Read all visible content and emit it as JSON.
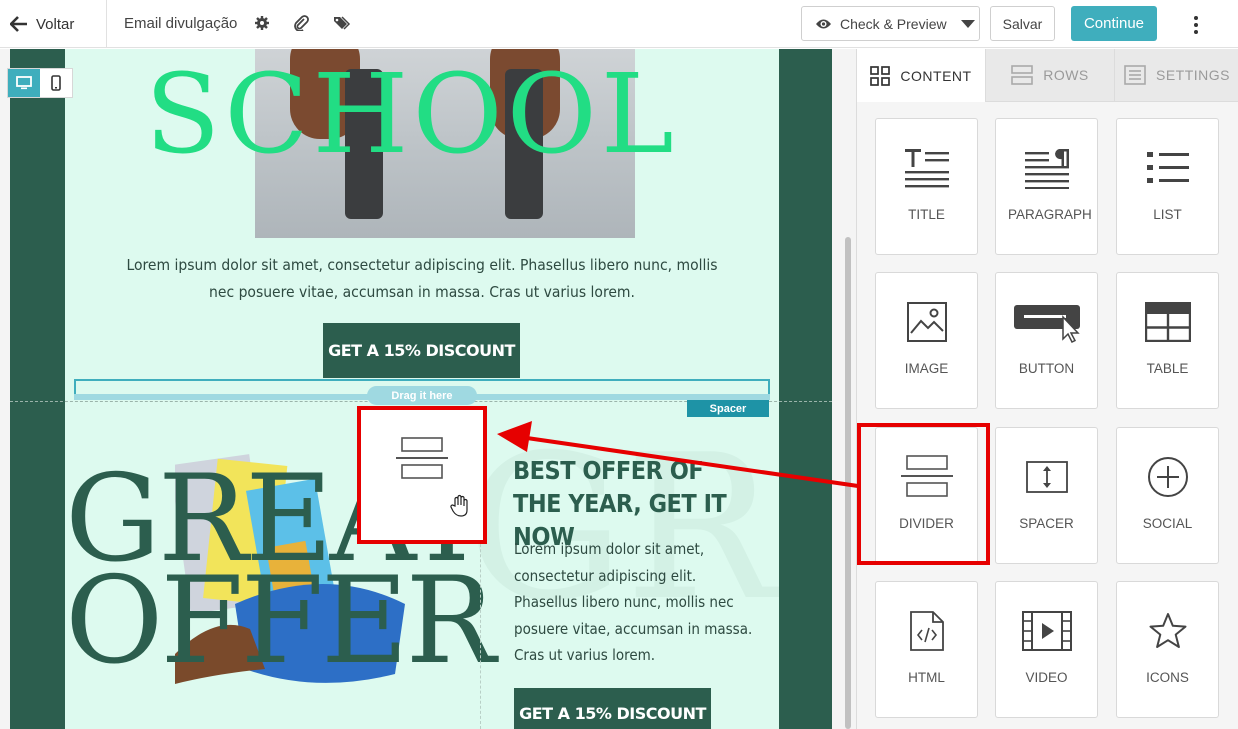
{
  "header": {
    "back_label": "Voltar",
    "email_name": "Email divulgação",
    "preview_label": "Check & Preview",
    "save_label": "Salvar",
    "continue_label": "Continue"
  },
  "canvas": {
    "hero_text": "SCHOOL",
    "paragraph1": "Lorem ipsum dolor sit amet, consectetur adipiscing elit. Phasellus libero nunc, mollis nec posuere vitae, accumsan in massa. Cras ut varius lorem.",
    "discount_button1": "GET A 15% DISCOUNT",
    "drag_label": "Drag it here",
    "spacer_tag": "Spacer",
    "offer_title": "BEST OFFER OF THE YEAR, GET IT NOW",
    "paragraph2": "Lorem ipsum dolor sit amet, consectetur adipiscing elit. Phasellus libero nunc, mollis nec posuere vitae, accumsan in massa. Cras ut varius lorem.",
    "great_text_line1": "GREAT",
    "great_text_line2": "OFFER",
    "discount_button2": "GET A 15% DISCOUNT"
  },
  "panel": {
    "tabs": [
      {
        "label": "CONTENT",
        "icon": "grid-icon",
        "active": true
      },
      {
        "label": "ROWS",
        "icon": "rows-icon",
        "active": false
      },
      {
        "label": "SETTINGS",
        "icon": "settings-icon",
        "active": false
      }
    ],
    "tiles": [
      {
        "label": "TITLE",
        "icon": "title-icon"
      },
      {
        "label": "PARAGRAPH",
        "icon": "paragraph-icon"
      },
      {
        "label": "LIST",
        "icon": "list-icon"
      },
      {
        "label": "IMAGE",
        "icon": "image-icon"
      },
      {
        "label": "BUTTON",
        "icon": "button-icon"
      },
      {
        "label": "TABLE",
        "icon": "table-icon"
      },
      {
        "label": "DIVIDER",
        "icon": "divider-icon"
      },
      {
        "label": "SPACER",
        "icon": "spacer-icon"
      },
      {
        "label": "SOCIAL",
        "icon": "social-icon"
      },
      {
        "label": "HTML",
        "icon": "html-icon"
      },
      {
        "label": "VIDEO",
        "icon": "video-icon"
      },
      {
        "label": "ICONS",
        "icon": "star-icon"
      }
    ]
  },
  "colors": {
    "accent": "#3faebd",
    "email_dark": "#2c5e4e",
    "email_light": "#ddfaef",
    "hero_green": "#22dd84",
    "annotation_red": "#e60000"
  }
}
